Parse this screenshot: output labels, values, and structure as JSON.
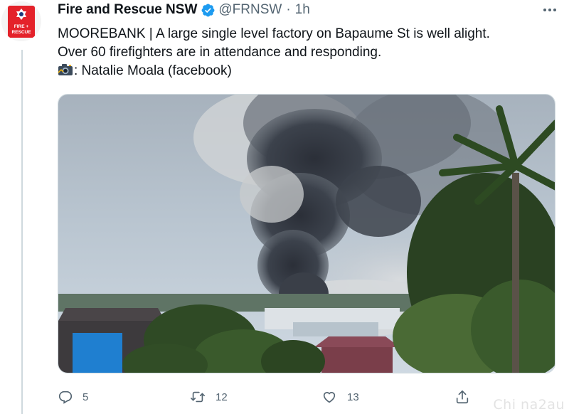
{
  "author": {
    "name": "Fire and Rescue NSW",
    "handle": "@FRNSW",
    "separator": "·",
    "time": "1h",
    "avatar_text": [
      "FIRE +",
      "RESCUE"
    ]
  },
  "tweet": {
    "line1": "MOOREBANK | A large single level factory on Bapaume St is well alight.",
    "line2": "Over 60 firefighters are in attendance and responding.",
    "line3": ": Natalie Moala (facebook)"
  },
  "actions": {
    "reply_count": "5",
    "retweet_count": "12",
    "like_count": "13"
  },
  "watermark": "Chi na2au",
  "colors": {
    "verified": "#1d9bf0",
    "text_secondary": "#536471",
    "brand_red": "#e4222a"
  },
  "icons": [
    "verified-badge-icon",
    "more-icon",
    "camera-icon",
    "reply-icon",
    "retweet-icon",
    "like-icon",
    "share-icon"
  ]
}
